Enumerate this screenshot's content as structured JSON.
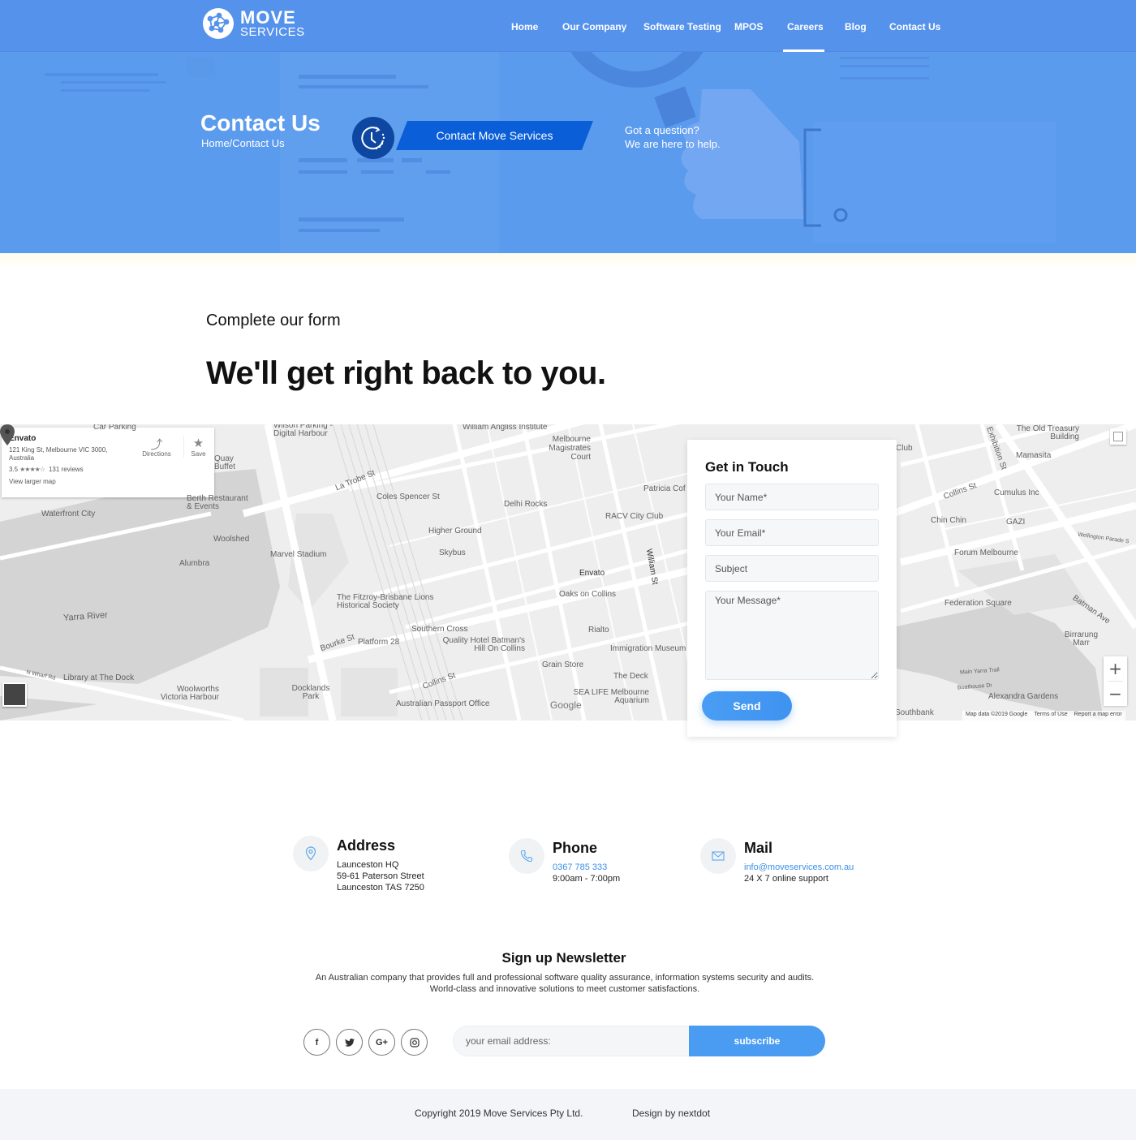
{
  "brand": {
    "name_line1": "MOVE",
    "name_line2": "SERVICES"
  },
  "nav": {
    "items": [
      {
        "label": "Home"
      },
      {
        "label": "Our Company"
      },
      {
        "label": "Software Testing"
      },
      {
        "label": "MPOS"
      },
      {
        "label": "Careers",
        "active": true
      },
      {
        "label": "Blog"
      },
      {
        "label": "Contact Us"
      }
    ]
  },
  "hero": {
    "title": "Contact Us",
    "breadcrumb": "Home/Contact Us",
    "cta_label": "Contact Move Services",
    "question_line1": "Got a question?",
    "question_line2": "We are here to help."
  },
  "intro": {
    "subtitle": "Complete our form",
    "title": "We'll get right back to you."
  },
  "map": {
    "place": {
      "name": "Envato",
      "address": "121 King St, Melbourne VIC 3000, Australia",
      "rating": "3.5",
      "stars": "★★★★☆",
      "reviews": "131 reviews",
      "larger_map_link": "View larger map",
      "directions_label": "Directions",
      "save_label": "Save"
    },
    "labels": {
      "car_parking": "Car Parking",
      "wilson": "Wilson Parking - Digital Harbour",
      "angliss": "William Angliss Institute",
      "magistrates": "Melbourne Magistrates Court",
      "la_trobe": "La Trobe St",
      "coles": "Coles Spencer St",
      "delhi": "Delhi Rocks",
      "patricia": "Patricia Cof",
      "racv": "RACV City Club",
      "higher_ground": "Higher Ground",
      "skybus": "Skybus",
      "marvel": "Marvel Stadium",
      "waterfront": "Waterfront City",
      "berth": "Berth Restaurant & Events",
      "quay": "Quay Buffet",
      "woolshed": "Woolshed",
      "alumbra": "Alumbra",
      "yarra": "Yarra River",
      "fitzroy": "The Fitzroy-Brisbane Lions Historical Society",
      "envato": "Envato",
      "oaks": "Oaks on Collins",
      "william": "William St",
      "southern_cross": "Southern Cross",
      "quality_hotel": "Quality Hotel Batman's Hill On Collins",
      "rialto": "Rialto",
      "immigration": "Immigration Museum",
      "platform28": "Platform 28",
      "bourke": "Bourke St",
      "grain_store": "Grain Store",
      "the_deck": "The Deck",
      "sea_life": "SEA LIFE Melbourne Aquarium",
      "collins": "Collins St",
      "passport": "Australian Passport Office",
      "library": "Library at The Dock",
      "woolworths": "Woolworths Victoria Harbour",
      "docklands_park": "Docklands Park",
      "n_wharf": "N Wharf Rd",
      "old_treasury": "The Old Treasury Building",
      "mamasita": "Mamasita",
      "exhibition": "Exhibition St",
      "collins_e": "Collins St",
      "cumulus": "Cumulus Inc",
      "chin_chin": "Chin Chin",
      "gazi": "GAZI",
      "wellington": "Wellington Parade S",
      "forum": "Forum Melbourne",
      "federation": "Federation Square",
      "batman_ave": "Batman Ave",
      "birrarung": "Birrarung Marr",
      "main_yarra": "Main Yarra Trail",
      "boathouse": "Boathouse Dr",
      "alexandra": "Alexandra Gardens",
      "southbank": "Southbank",
      "club": "Club"
    },
    "google": "Google",
    "attribution": {
      "data": "Map data ©2019 Google",
      "terms": "Terms of Use",
      "report": "Report a map error"
    },
    "zoom_in": "+",
    "zoom_out": "−"
  },
  "form": {
    "title": "Get in Touch",
    "name_placeholder": "Your Name*",
    "email_placeholder": "Your Email*",
    "subject_placeholder": "Subject",
    "message_placeholder": "Your Message*",
    "send_label": "Send"
  },
  "contact": {
    "address": {
      "title": "Address",
      "line1": "Launceston HQ",
      "line2": "59-61 Paterson Street",
      "line3": "Launceston TAS 7250",
      "icon": "map-pin-icon"
    },
    "phone": {
      "title": "Phone",
      "number": "0367 785 333",
      "hours": "9:00am - 7:00pm",
      "icon": "phone-icon"
    },
    "mail": {
      "title": "Mail",
      "email": "info@moveservices.com.au",
      "support": "24 X 7 online support",
      "icon": "envelope-icon"
    }
  },
  "newsletter": {
    "title": "Sign up Newsletter",
    "desc_line1": "An Australian company that provides full and professional software quality assurance, information systems security and audits.",
    "desc_line2": "World-class and innovative solutions to meet customer satisfactions.",
    "social": [
      {
        "name": "facebook",
        "glyph": "f"
      },
      {
        "name": "twitter",
        "glyph": "t"
      },
      {
        "name": "google-plus",
        "glyph": "G+"
      },
      {
        "name": "instagram",
        "glyph": "◎"
      }
    ],
    "email_placeholder": "your email address:",
    "subscribe_label": "subscribe"
  },
  "footer": {
    "copyright": "Copyright 2019 Move Services Pty Ltd.",
    "design": "Design by nextdot"
  },
  "colors": {
    "nav_bg": "#5592ec",
    "hero_bg": "#5b9bee",
    "cta_bg": "#0a5fd8",
    "clock_circle": "#0d47a1",
    "accent": "#4a9cf2",
    "link": "#3b8fea",
    "footer_bg": "#f4f5f8"
  }
}
